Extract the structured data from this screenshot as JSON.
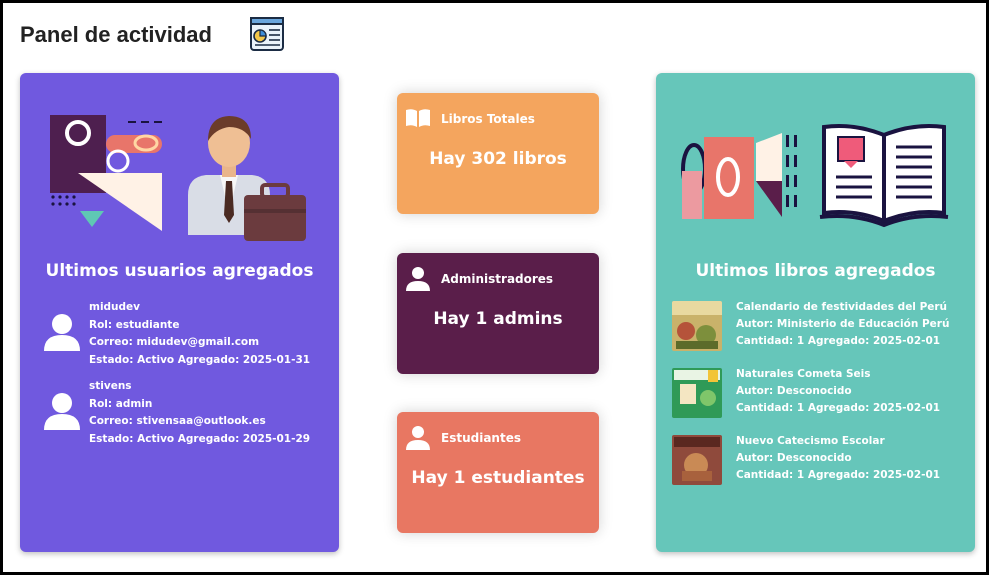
{
  "header": {
    "title": "Panel de actividad",
    "icon": "dashboard-report-icon"
  },
  "colors": {
    "users_card": "#7059df",
    "books_card": "#66c6ba",
    "total_books": "#f4a55e",
    "admins": "#5a1e4a",
    "students": "#e87762"
  },
  "stats": {
    "books": {
      "label": "Libros Totales",
      "value": "Hay 302 libros",
      "icon": "book-icon"
    },
    "admins": {
      "label": "Administradores",
      "value": "Hay 1 admins",
      "icon": "user-icon"
    },
    "students": {
      "label": "Estudiantes",
      "value": "Hay 1 estudiantes",
      "icon": "user-icon"
    }
  },
  "users_panel": {
    "title": "Ultimos usuarios agregados",
    "users": [
      {
        "name": "midudev",
        "role": "Rol: estudiante",
        "email": "Correo: midudev@gmail.com",
        "status": "Estado: Activo  Agregado: 2025-01-31"
      },
      {
        "name": "stivens",
        "role": "Rol: admin",
        "email": "Correo: stivensaa@outlook.es",
        "status": "Estado: Activo  Agregado: 2025-01-29"
      }
    ]
  },
  "books_panel": {
    "title": "Ultimos libros agregados",
    "books": [
      {
        "title": "Calendario de festividades del Perú",
        "author": "Autor: Ministerio de Educación Perú",
        "meta": "Cantidad: 1  Agregado: 2025-02-01"
      },
      {
        "title": "Naturales Cometa Seis",
        "author": "Autor: Desconocido",
        "meta": "Cantidad: 1  Agregado: 2025-02-01"
      },
      {
        "title": "Nuevo Catecismo Escolar",
        "author": "Autor: Desconocido",
        "meta": "Cantidad: 1  Agregado: 2025-02-01"
      }
    ]
  }
}
